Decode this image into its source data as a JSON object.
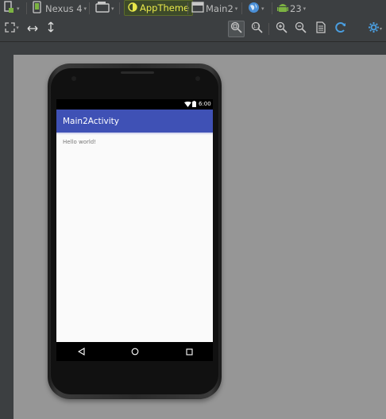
{
  "toolbar": {
    "device": "Nexus 4",
    "theme": "AppTheme",
    "activity": "Main2",
    "api_level": "23"
  },
  "phone": {
    "status_time": "6:00",
    "app_title": "Main2Activity",
    "content_text": "Hello world!"
  },
  "colors": {
    "primary": "#3f51b5",
    "canvas_bg": "#969696",
    "ide_bg": "#3c3f41",
    "theme_text": "#e8e84a"
  },
  "icons": [
    "design-surface-icon",
    "device-icon",
    "orientation-icon",
    "theme-icon",
    "activity-icon",
    "locale-icon",
    "android-icon",
    "zoom-fit-icon",
    "expand-horizontal-icon",
    "expand-vertical-icon",
    "zoom-to-fit-icon",
    "actual-size-icon",
    "zoom-in-icon",
    "zoom-out-icon",
    "file-icon",
    "refresh-icon",
    "settings-icon"
  ]
}
